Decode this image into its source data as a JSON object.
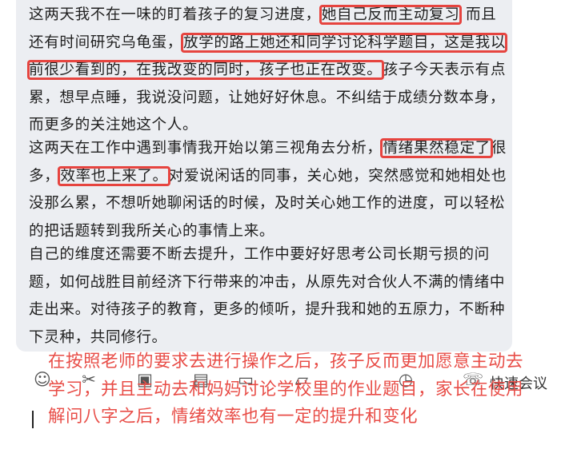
{
  "message": {
    "p1": {
      "s1": "这两天我不在一味的盯着孩子的复习进度，",
      "h1": "她自己反而主动复习",
      "s2": " 而且还有时间研究乌龟蛋，",
      "h2": "放学的路上她还和同学讨论科学题目，这是我以前很少看到的，在我改变的同时，孩子也正在改变。",
      "s3": "孩子今天表示有点累，想早点睡，我说没问题，让她好好休息。不纠结于成绩分数本身，而更多的关注她这个人。"
    },
    "p2": {
      "s1": "这两天在工作中遇到事情我开始以第三视角去分析，",
      "h1": "情绪果然稳定了",
      "s2": "很多，",
      "h2": "效率也上来了。",
      "s3": "对爱说闲话的同事，关心她，突然感觉和她相处也没那么累，不想听她聊闲话的时候，及时关心她工作的进度，可以轻松的把话题转到我所关心的事情上来。"
    },
    "p3": "自己的维度还需要不断去提升，工作中要好好思考公司长期亏损的问题，如何战胜目前经济下行带来的冲击，从原先对合伙人不满的情绪中走出来。对待孩子的教育，更多的倾听，提升我和她的五原力，不断种下灵种，共同修行。"
  },
  "toolbar": {
    "icons": [
      "emoji-icon",
      "scissors-icon",
      "image-icon",
      "document-icon",
      "chat-icon",
      "folder-icon",
      "history-icon",
      "quick-meeting-icon"
    ],
    "quick_meeting_label": "快速会议"
  },
  "annotation": {
    "text": "在按照老师的要求去进行操作之后，孩子反而更加愿意主动去学习，并且主动去和妈妈讨论学校里的作业题目，家长在使用解问八字之后，情绪效率也有一定的提升和变化",
    "color": "#e84d47"
  },
  "colors": {
    "highlight_box": "#e6443f",
    "bubble_bg": "#eceef2",
    "body_text": "#1f1f1f"
  }
}
